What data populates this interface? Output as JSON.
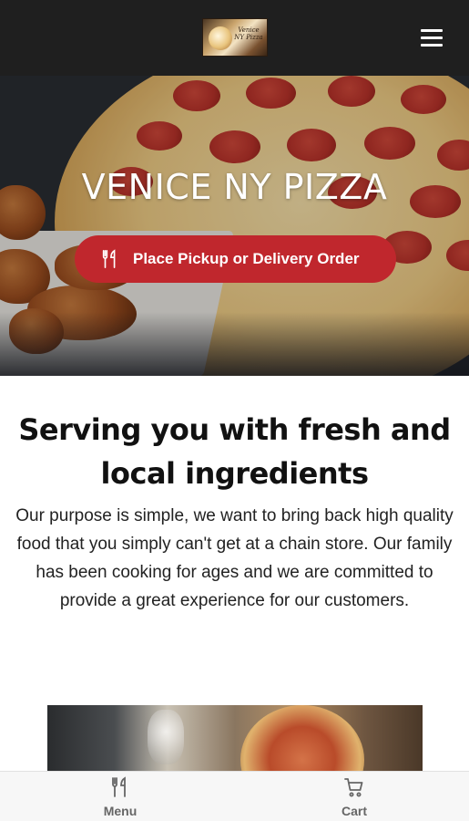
{
  "header": {
    "logo_text": "Venice NY Pizza",
    "menu_icon": "hamburger-icon"
  },
  "hero": {
    "title": "VENICE NY PIZZA",
    "order_button": {
      "label": "Place Pickup or Delivery Order",
      "icon": "fork-knife-icon"
    }
  },
  "content": {
    "headline": "Serving you with fresh and local ingredients",
    "body": "Our purpose is simple, we want to bring back high quality food that you simply can't get at a chain store. Our family has been cooking for ages and we are committed to provide a great experience for our customers."
  },
  "bottom_nav": {
    "items": [
      {
        "label": "Menu",
        "icon": "fork-knife-icon"
      },
      {
        "label": "Cart",
        "icon": "cart-icon"
      }
    ]
  },
  "colors": {
    "header_bg": "#1f1f1f",
    "accent_red": "#c0272d",
    "nav_bg": "#f7f7f7"
  }
}
